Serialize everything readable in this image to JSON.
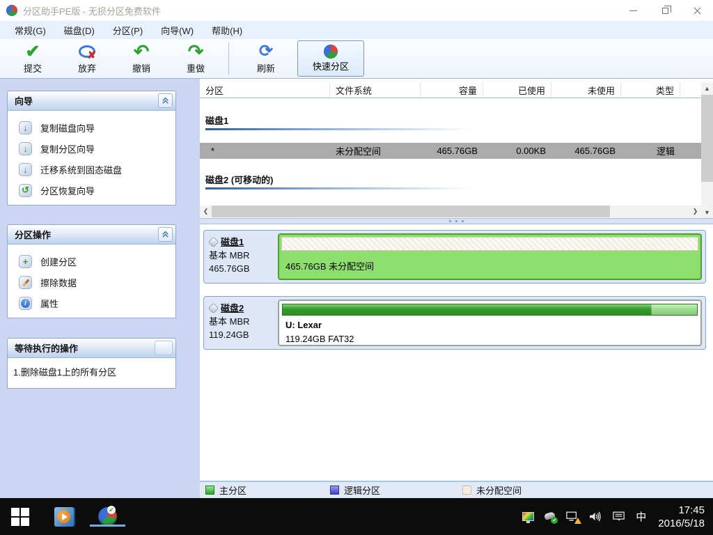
{
  "window": {
    "title": "分区助手PE版 - 无损分区免费软件"
  },
  "menu": {
    "items": [
      {
        "label": "常规(G)"
      },
      {
        "label": "磁盘(D)"
      },
      {
        "label": "分区(P)"
      },
      {
        "label": "向导(W)"
      },
      {
        "label": "帮助(H)"
      }
    ]
  },
  "toolbar": {
    "buttons": [
      {
        "label": "提交"
      },
      {
        "label": "放弃"
      },
      {
        "label": "撤销"
      },
      {
        "label": "重做"
      },
      {
        "label": "刷新"
      },
      {
        "label": "快速分区"
      }
    ]
  },
  "sidebar": {
    "sections": [
      {
        "title": "向导",
        "items": [
          {
            "label": "复制磁盘向导"
          },
          {
            "label": "复制分区向导"
          },
          {
            "label": "迁移系统到固态磁盘"
          },
          {
            "label": "分区恢复向导"
          }
        ]
      },
      {
        "title": "分区操作",
        "items": [
          {
            "label": "创建分区"
          },
          {
            "label": "擦除数据"
          },
          {
            "label": "属性"
          }
        ]
      },
      {
        "title": "等待执行的操作",
        "items": [
          {
            "label": "1.删除磁盘1上的所有分区"
          }
        ]
      }
    ]
  },
  "table": {
    "columns": [
      "分区",
      "文件系统",
      "容量",
      "已使用",
      "未使用",
      "类型"
    ],
    "disk1_label": "磁盘1",
    "disk2_label": "磁盘2 (可移动的)",
    "selected_row": {
      "partition": "*",
      "filesystem": "未分配空间",
      "capacity": "465.76GB",
      "used": "0.00KB",
      "unused": "465.76GB",
      "type": "逻辑"
    }
  },
  "disks": [
    {
      "name": "磁盘1",
      "scheme": "基本 MBR",
      "size": "465.76GB",
      "partition_text": "465.76GB 未分配空间"
    },
    {
      "name": "磁盘2",
      "scheme": "基本 MBR",
      "size": "119.24GB",
      "volume": "U: Lexar",
      "volume_detail": "119.24GB FAT32",
      "used_percent": 89
    }
  ],
  "legend": {
    "items": [
      {
        "label": "主分区",
        "color": "#28a428"
      },
      {
        "label": "逻辑分区",
        "color": "#4242c8"
      },
      {
        "label": "未分配空间",
        "color": "#f2eddf"
      }
    ]
  },
  "colors": {
    "selection_row": "#ababab",
    "unallocated_block_green": "#8ede6d",
    "sidebar_background": "#cbd7f2",
    "taskbar_active_underline": "#76aee0"
  },
  "taskbar": {
    "time": "17:45",
    "date": "2016/5/18",
    "ime": "中"
  }
}
